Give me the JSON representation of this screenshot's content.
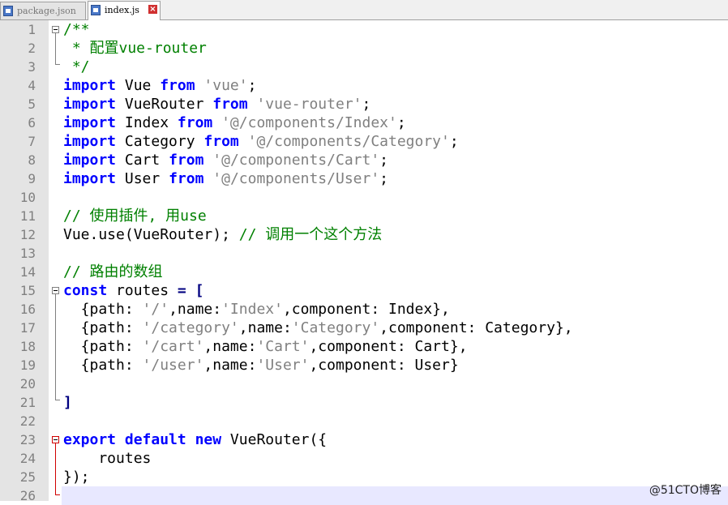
{
  "tabs": [
    {
      "label": "package.json",
      "active": false
    },
    {
      "label": "index.js",
      "active": true
    }
  ],
  "editor": {
    "current_line": 26,
    "lines": [
      {
        "n": "1",
        "segs": [
          [
            "cm",
            "/**"
          ]
        ]
      },
      {
        "n": "2",
        "segs": [
          [
            "cm",
            " * 配置vue-router"
          ]
        ]
      },
      {
        "n": "3",
        "segs": [
          [
            "cm",
            " */"
          ]
        ]
      },
      {
        "n": "4",
        "segs": [
          [
            "kw",
            "import"
          ],
          [
            "",
            " Vue "
          ],
          [
            "kw",
            "from"
          ],
          [
            "",
            " "
          ],
          [
            "str",
            "'vue'"
          ],
          [
            "",
            ";"
          ]
        ]
      },
      {
        "n": "5",
        "segs": [
          [
            "kw",
            "import"
          ],
          [
            "",
            " VueRouter "
          ],
          [
            "kw",
            "from"
          ],
          [
            "",
            " "
          ],
          [
            "str",
            "'vue-router'"
          ],
          [
            "",
            ";"
          ]
        ]
      },
      {
        "n": "6",
        "segs": [
          [
            "kw",
            "import"
          ],
          [
            "",
            " Index "
          ],
          [
            "kw",
            "from"
          ],
          [
            "",
            " "
          ],
          [
            "str",
            "'@/components/Index'"
          ],
          [
            "",
            ";"
          ]
        ]
      },
      {
        "n": "7",
        "segs": [
          [
            "kw",
            "import"
          ],
          [
            "",
            " Category "
          ],
          [
            "kw",
            "from"
          ],
          [
            "",
            " "
          ],
          [
            "str",
            "'@/components/Category'"
          ],
          [
            "",
            ";"
          ]
        ]
      },
      {
        "n": "8",
        "segs": [
          [
            "kw",
            "import"
          ],
          [
            "",
            " Cart "
          ],
          [
            "kw",
            "from"
          ],
          [
            "",
            " "
          ],
          [
            "str",
            "'@/components/Cart'"
          ],
          [
            "",
            ";"
          ]
        ]
      },
      {
        "n": "9",
        "segs": [
          [
            "kw",
            "import"
          ],
          [
            "",
            " User "
          ],
          [
            "kw",
            "from"
          ],
          [
            "",
            " "
          ],
          [
            "str",
            "'@/components/User'"
          ],
          [
            "",
            ";"
          ]
        ]
      },
      {
        "n": "10",
        "segs": []
      },
      {
        "n": "11",
        "segs": [
          [
            "cm",
            "// 使用插件, 用use"
          ]
        ]
      },
      {
        "n": "12",
        "segs": [
          [
            "",
            "Vue.use(VueRouter); "
          ],
          [
            "cm",
            "// 调用一个这个方法"
          ]
        ]
      },
      {
        "n": "13",
        "segs": []
      },
      {
        "n": "14",
        "segs": [
          [
            "cm",
            "// 路由的数组"
          ]
        ]
      },
      {
        "n": "15",
        "segs": [
          [
            "kw",
            "const"
          ],
          [
            "",
            " routes "
          ],
          [
            "op",
            "="
          ],
          [
            "",
            " "
          ],
          [
            "op",
            "["
          ]
        ]
      },
      {
        "n": "16",
        "segs": [
          [
            "",
            "  {path: "
          ],
          [
            "str",
            "'/'"
          ],
          [
            "",
            ",name:"
          ],
          [
            "str",
            "'Index'"
          ],
          [
            "",
            ",component: Index},"
          ]
        ]
      },
      {
        "n": "17",
        "segs": [
          [
            "",
            "  {path: "
          ],
          [
            "str",
            "'/category'"
          ],
          [
            "",
            ",name:"
          ],
          [
            "str",
            "'Category'"
          ],
          [
            "",
            ",component: Category},"
          ]
        ]
      },
      {
        "n": "18",
        "segs": [
          [
            "",
            "  {path: "
          ],
          [
            "str",
            "'/cart'"
          ],
          [
            "",
            ",name:"
          ],
          [
            "str",
            "'Cart'"
          ],
          [
            "",
            ",component: Cart},"
          ]
        ]
      },
      {
        "n": "19",
        "segs": [
          [
            "",
            "  {path: "
          ],
          [
            "str",
            "'/user'"
          ],
          [
            "",
            ",name:"
          ],
          [
            "str",
            "'User'"
          ],
          [
            "",
            ",component: User}"
          ]
        ]
      },
      {
        "n": "20",
        "segs": []
      },
      {
        "n": "21",
        "segs": [
          [
            "op",
            "]"
          ]
        ]
      },
      {
        "n": "22",
        "segs": []
      },
      {
        "n": "23",
        "segs": [
          [
            "kw",
            "export"
          ],
          [
            "",
            " "
          ],
          [
            "kw",
            "default"
          ],
          [
            "",
            " "
          ],
          [
            "kw",
            "new"
          ],
          [
            "",
            " VueRouter({"
          ]
        ]
      },
      {
        "n": "24",
        "segs": [
          [
            "",
            "    routes"
          ]
        ]
      },
      {
        "n": "25",
        "segs": [
          [
            "",
            "});"
          ]
        ]
      },
      {
        "n": "26",
        "segs": []
      }
    ]
  },
  "watermark": "@51CTO博客",
  "colors": {
    "keyword": "#0000ff",
    "string": "#808080",
    "comment": "#008000",
    "gutter_bg": "#e4e4e4",
    "current_line_bg": "#e8e8ff",
    "fold_red": "#d00000"
  }
}
